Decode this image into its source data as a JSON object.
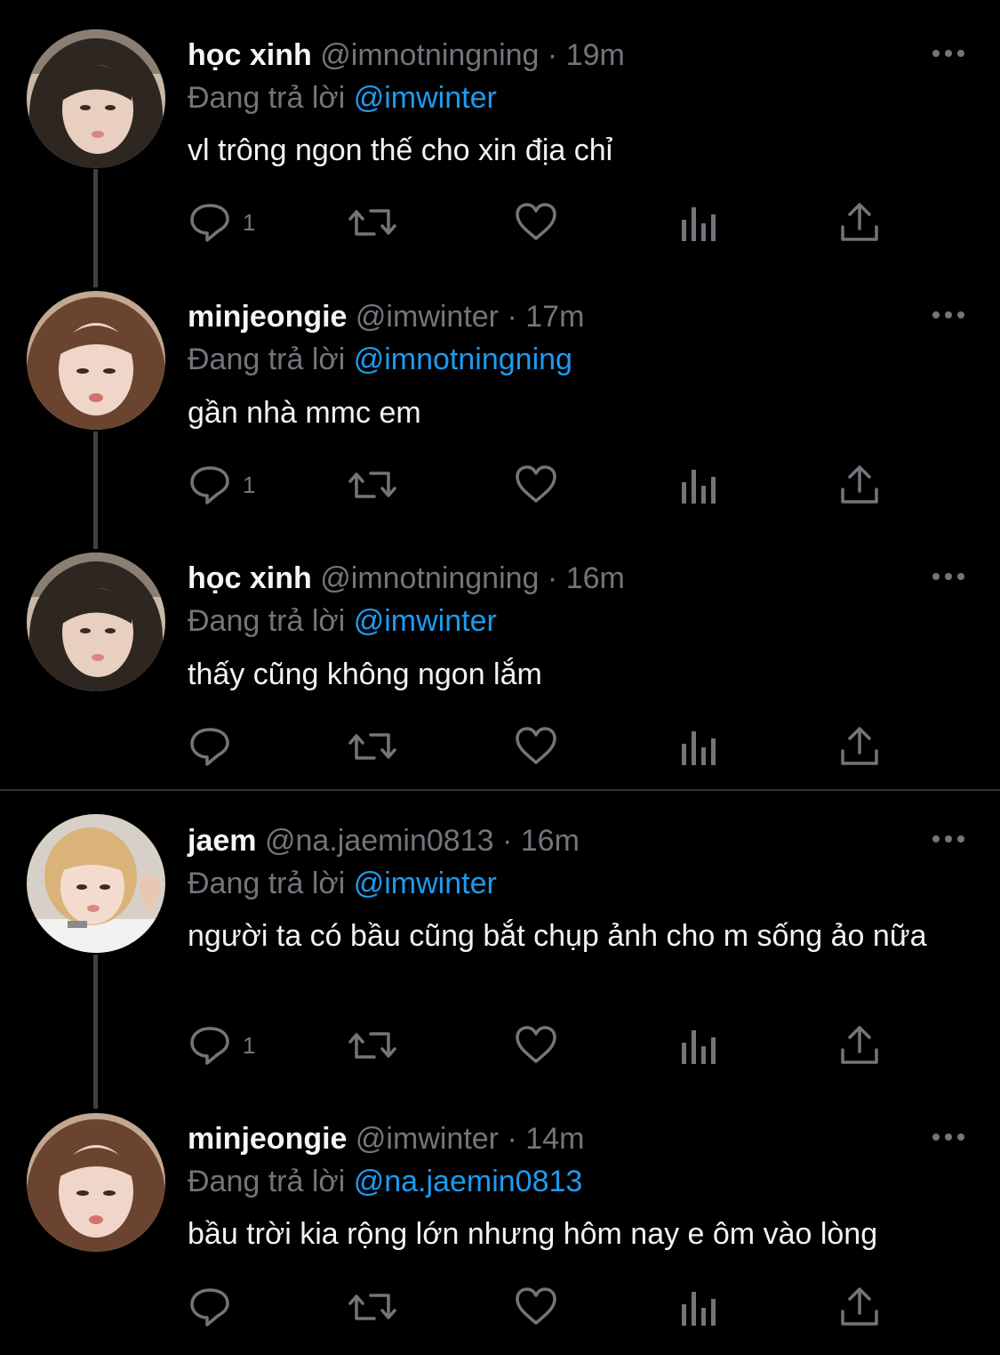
{
  "tweets": [
    {
      "name": "học xinh",
      "handle": "@imnotningning",
      "sep": "·",
      "time": "19m",
      "replying_prefix": "Đang trả lời",
      "replying_to": "@imwinter",
      "text": "vl trông ngon thế cho xin địa chỉ",
      "reply_count": "1",
      "avatar_icon": "avatar-girl-long-dark-hair"
    },
    {
      "name": "minjeongie",
      "handle": "@imwinter",
      "sep": "·",
      "time": "17m",
      "replying_prefix": "Đang trả lời",
      "replying_to": "@imnotningning",
      "text": "gần nhà mmc em",
      "reply_count": "1",
      "avatar_icon": "avatar-girl-brown-hair"
    },
    {
      "name": "học xinh",
      "handle": "@imnotningning",
      "sep": "·",
      "time": "16m",
      "replying_prefix": "Đang trả lời",
      "replying_to": "@imwinter",
      "text": "thấy cũng không ngon lắm",
      "reply_count": "",
      "avatar_icon": "avatar-girl-long-dark-hair"
    },
    {
      "name": "jaem",
      "handle": "@na.jaemin0813",
      "sep": "·",
      "time": "16m",
      "replying_prefix": "Đang trả lời",
      "replying_to": "@imwinter",
      "text": "người ta có bầu cũng bắt chụp ảnh cho m sống ảo nữa",
      "reply_count": "1",
      "avatar_icon": "avatar-boy-blond-hair"
    },
    {
      "name": "minjeongie",
      "handle": "@imwinter",
      "sep": "·",
      "time": "14m",
      "replying_prefix": "Đang trả lời",
      "replying_to": "@na.jaemin0813",
      "text": "bầu trời kia rộng lớn nhưng hôm nay e ôm vào lòng",
      "reply_count": "",
      "avatar_icon": "avatar-girl-brown-hair"
    }
  ],
  "colors": {
    "background": "#000000",
    "mention": "#1d9bf0",
    "muted": "#71767b",
    "thread_line": "#3e4144"
  }
}
